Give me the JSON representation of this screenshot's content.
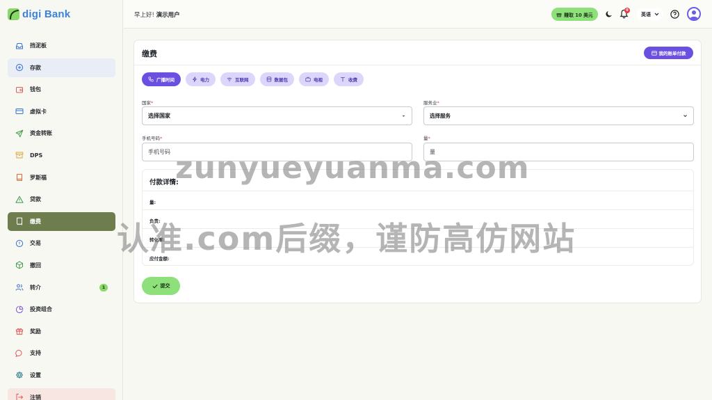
{
  "app": {
    "logo_text": "digi Bank"
  },
  "sidebar": {
    "items": [
      {
        "label": "挡泥板",
        "icon": "inbox-icon"
      },
      {
        "label": "存款",
        "icon": "plus-circle-icon"
      },
      {
        "label": "钱包",
        "icon": "wallet-icon"
      },
      {
        "label": "虚拟卡",
        "icon": "credit-card-icon"
      },
      {
        "label": "资金转账",
        "icon": "send-icon"
      },
      {
        "label": "DPS",
        "icon": "archive-icon"
      },
      {
        "label": "罗斯福",
        "icon": "book-icon"
      },
      {
        "label": "贷款",
        "icon": "warning-icon"
      },
      {
        "label": "缴费",
        "icon": "receipt-icon"
      },
      {
        "label": "交易",
        "icon": "info-circle-icon"
      },
      {
        "label": "撤回",
        "icon": "box-icon"
      },
      {
        "label": "转介",
        "icon": "users-icon",
        "badge": "1"
      },
      {
        "label": "投资组合",
        "icon": "pie-chart-icon"
      },
      {
        "label": "奖励",
        "icon": "gift-icon"
      },
      {
        "label": "支持",
        "icon": "chat-icon"
      },
      {
        "label": "设置",
        "icon": "gear-icon"
      },
      {
        "label": "注销",
        "icon": "logout-icon"
      }
    ]
  },
  "header": {
    "greeting": "早上好!",
    "username": "演示用户",
    "earn_label": "赚取 10 美元",
    "notification_count": "0",
    "language": "英语"
  },
  "card": {
    "title": "缴费",
    "bills_button": "我的账单付款",
    "tabs": [
      {
        "label": "广播时间",
        "icon": "phone-icon"
      },
      {
        "label": "电力",
        "icon": "bolt-icon"
      },
      {
        "label": "互联网",
        "icon": "wifi-icon"
      },
      {
        "label": "数据包",
        "icon": "database-icon"
      },
      {
        "label": "电视",
        "icon": "tv-icon"
      },
      {
        "label": "收费",
        "icon": "text-icon"
      }
    ],
    "country_label": "国家",
    "country_value": "选择国家",
    "service_label": "服务业",
    "service_value": "选择服务",
    "phone_label": "手机号码",
    "phone_placeholder": "手机号码",
    "amount_label": "量",
    "amount_placeholder": "量",
    "details_title": "付款详情:",
    "detail_rows": [
      "量:",
      "负责:",
      "转化率:",
      "应付金额:"
    ],
    "submit_label": "提交"
  },
  "watermark": {
    "line1": "zunyueyuanma.com",
    "line2": "认准.com后缀，谨防高仿网站"
  },
  "colors": {
    "accent_purple": "#6b4fe0",
    "accent_green": "#8de07a",
    "active_nav": "#6e7d4d"
  }
}
